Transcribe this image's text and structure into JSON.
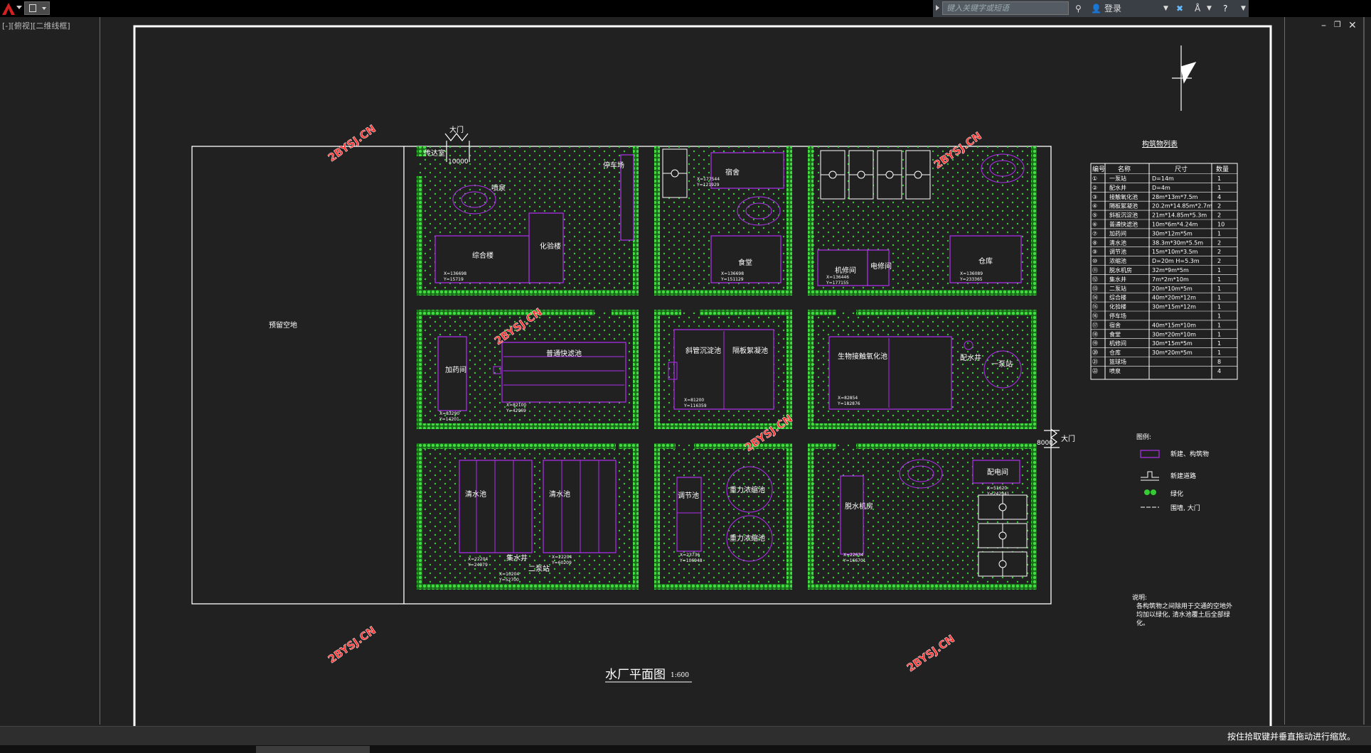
{
  "app": {
    "search_placeholder": "键入关键字或短语",
    "login_label": "登录"
  },
  "viewport": {
    "label": "[-][俯视][二维线框]"
  },
  "command": {
    "hint": "按住拾取键并垂直拖动进行缩放。"
  },
  "drawing": {
    "title": "水厂平面图",
    "scale": "1:600",
    "reserve_area": "预留空地",
    "gate_top": "大门",
    "gate_top_width": "10000",
    "gate_right": "大门",
    "gate_right_width": "8000",
    "guard_room": "传达室",
    "watermarks": [
      "2BYSJ.CN",
      "2BYSJ.CN",
      "2BYSJ.CN",
      "2BYSJ.CN",
      "2BYSJ.CN",
      "2BYSJ.CN"
    ],
    "buildings": {
      "fountain": "喷泉",
      "office": "综合楼",
      "lab": "化验楼",
      "parking": "停车场",
      "dorm": "宿舍",
      "canteen": "食堂",
      "repair": "机修间",
      "elevator": "电修间",
      "warehouse": "仓库",
      "dosing": "加药间",
      "filter": "普通快滤池",
      "inclined_settle": "斜管沉淀池",
      "flocculation": "隔板絮凝池",
      "bio_oxidation": "生物接触氧化池",
      "distribution_well": "配水井",
      "pump_station_1": "一泵站",
      "clear_water_1": "清水池",
      "clear_water_2": "清水池",
      "collect_well": "集水井",
      "pump_station_2": "二泵站",
      "regulating": "调节池",
      "thickener_1": "重力浓缩池",
      "thickener_2": "重力浓缩池",
      "dewater": "脱水机房",
      "substation": "配电间"
    },
    "coords": {
      "office": [
        "X=136698",
        "Y=15719"
      ],
      "dorm": [
        "X=177544",
        "Y=121929"
      ],
      "canteen": [
        "X=136698",
        "Y=151129"
      ],
      "repair": [
        "X=136446",
        "Y=177155"
      ],
      "warehouse": [
        "X=136089",
        "Y=233365"
      ],
      "dosing": [
        "X=83290",
        "Y=14201"
      ],
      "filter": [
        "X=82100",
        "Y=42969"
      ],
      "settle": [
        "X=81200",
        "Y=116359"
      ],
      "bio": [
        "X=82854",
        "Y=182876"
      ],
      "clear1": [
        "X=22204",
        "Y=24979"
      ],
      "clear2": [
        "X=22204",
        "Y=60209"
      ],
      "pump2": [
        "X=10204",
        "Y=52700"
      ],
      "regulating": [
        "X=23736",
        "Y=106948"
      ],
      "dewater": [
        "X=22634",
        "Y=166701"
      ],
      "substation": [
        "X=51620",
        "Y=242941"
      ]
    },
    "table": {
      "title": "构筑物列表",
      "headers": [
        "编号",
        "名称",
        "尺寸",
        "数量"
      ],
      "rows": [
        [
          "①",
          "一泵站",
          "D=14m",
          "1"
        ],
        [
          "②",
          "配水井",
          "D=4m",
          "1"
        ],
        [
          "③",
          "接触氧化池",
          "28m*13m*7.5m",
          "4"
        ],
        [
          "④",
          "隔板絮凝池",
          "20.2m*14.85m*2.7m",
          "2"
        ],
        [
          "⑤",
          "斜板沉淀池",
          "21m*14.85m*5.3m",
          "2"
        ],
        [
          "⑥",
          "普通快滤池",
          "10m*6m*4.24m",
          "10"
        ],
        [
          "⑦",
          "加药间",
          "30m*12m*5m",
          "1"
        ],
        [
          "⑧",
          "清水池",
          "38.3m*30m*5.5m",
          "2"
        ],
        [
          "⑨",
          "调节池",
          "15m*10m*3.5m",
          "2"
        ],
        [
          "⑩",
          "浓缩池",
          "D=20m H=5.3m",
          "2"
        ],
        [
          "⑪",
          "脱水机房",
          "32m*9m*5m",
          "1"
        ],
        [
          "⑫",
          "集水井",
          "7m*2m*10m",
          "1"
        ],
        [
          "⑬",
          "二泵站",
          "20m*10m*5m",
          "1"
        ],
        [
          "⑭",
          "综合楼",
          "40m*20m*12m",
          "1"
        ],
        [
          "⑮",
          "化验楼",
          "30m*15m*12m",
          "1"
        ],
        [
          "⑯",
          "停车场",
          "",
          "1"
        ],
        [
          "⑰",
          "宿舍",
          "40m*15m*10m",
          "1"
        ],
        [
          "⑱",
          "食堂",
          "30m*20m*10m",
          "1"
        ],
        [
          "⑲",
          "机修间",
          "30m*15m*5m",
          "1"
        ],
        [
          "⑳",
          "仓库",
          "30m*20m*5m",
          "1"
        ],
        [
          "㉑",
          "篮球场",
          "",
          "8"
        ],
        [
          "㉒",
          "喷泉",
          "",
          "4"
        ]
      ]
    },
    "legend": {
      "title": "图例:",
      "items": [
        "新建、构筑物",
        "新建道路",
        "绿化",
        "围墙, 大门"
      ]
    },
    "notes": {
      "title": "说明:",
      "lines": [
        "各构筑物之间除用于交通的空地外",
        "均加以绿化, 清水池覆土后全部绿",
        "化。"
      ]
    },
    "colors": {
      "green": "#33cc33",
      "purple": "#a020f0",
      "white": "#ffffff",
      "red": "#e02020"
    }
  }
}
